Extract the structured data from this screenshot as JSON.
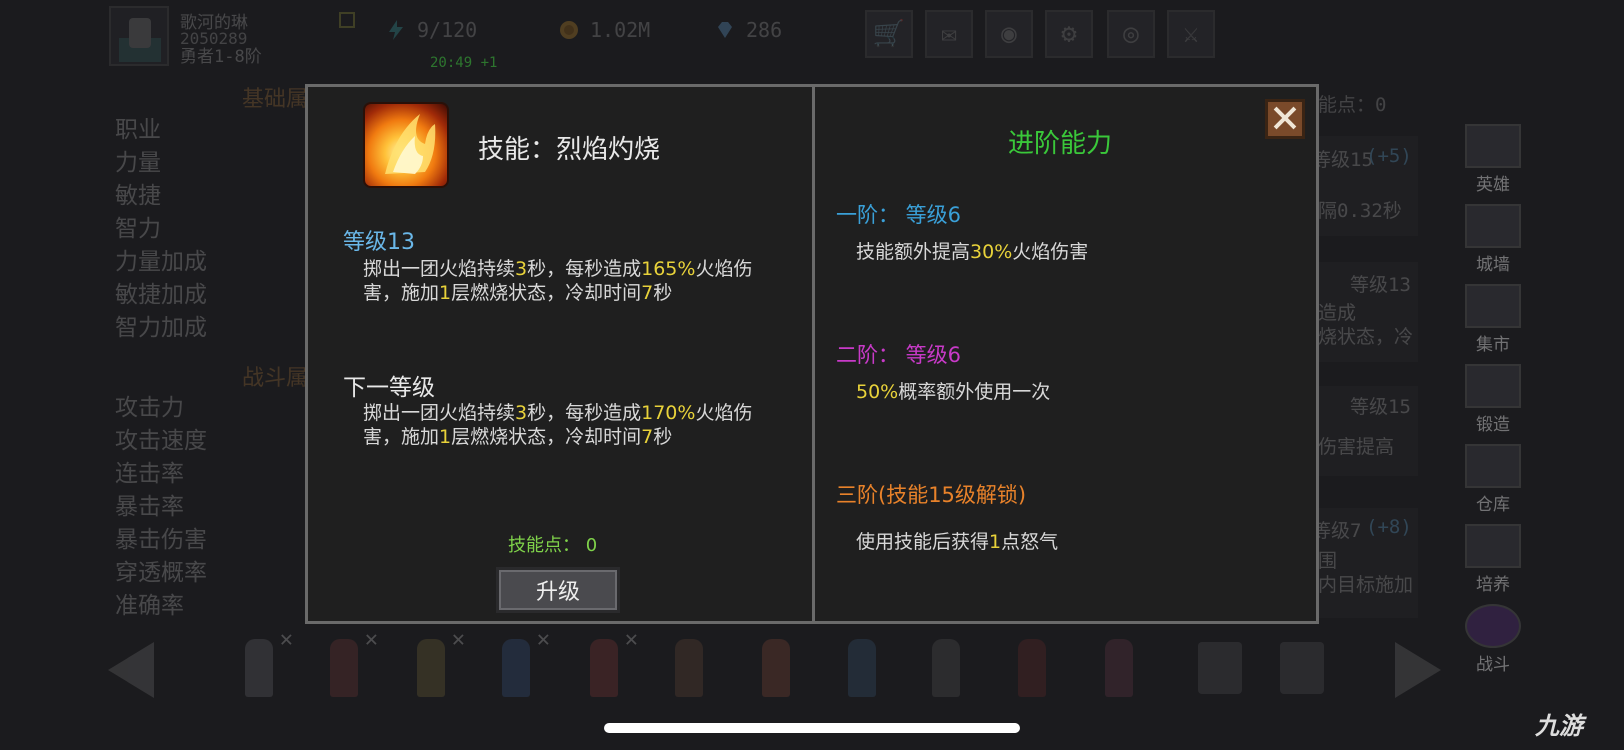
{
  "player": {
    "name": "歌河的琳",
    "id": "2050289",
    "rank": "勇者1-8阶"
  },
  "stats": {
    "energy": "9/120",
    "energy_timer": "20:49 +1",
    "gold": "1.02M",
    "gems": "286"
  },
  "background": {
    "basic_title": "基础属",
    "combat_title": "战斗属",
    "basic_stats": [
      "职业",
      "力量",
      "敏捷",
      "智力",
      "力量加成",
      "敏捷加成",
      "智力加成"
    ],
    "combat_stats": [
      "攻击力",
      "攻击速度",
      "连击率",
      "暴击率",
      "暴击伤害",
      "穿透概率",
      "准确率"
    ],
    "skill_points": "能点：0",
    "cards": [
      {
        "lines": [
          "等级15",
          "(+5)",
          "隔0.32秒"
        ]
      },
      {
        "lines": [
          "等级13",
          "造成",
          "烧状态，冷"
        ]
      },
      {
        "lines": [
          "等级15",
          "伤害提高"
        ]
      },
      {
        "lines": [
          "等级7",
          "(+8)",
          "围",
          "内目标施加"
        ]
      }
    ]
  },
  "nav": [
    "英雄",
    "城墙",
    "集市",
    "锻造",
    "仓库",
    "培养",
    "战斗"
  ],
  "modal": {
    "skill_title": "技能：烈焰灼烧",
    "level": "等级13",
    "current_desc": [
      "掷出一团火焰持续",
      "3",
      "秒，每秒造成",
      "165%",
      "火焰伤害，施加",
      "1",
      "层燃烧状态，冷却时间",
      "7",
      "秒"
    ],
    "next_label": "下一等级",
    "next_desc": [
      "掷出一团火焰持续",
      "3",
      "秒，每秒造成",
      "170%",
      "火焰伤害，施加",
      "1",
      "层燃烧状态，冷却时间",
      "7",
      "秒"
    ],
    "skill_points": "技能点： 0",
    "upgrade_label": "升级",
    "advanced_title": "进阶能力",
    "tiers": [
      {
        "label": "一阶： 等级6",
        "color": "#3aa0d8",
        "desc": [
          "技能额外提高",
          "30%",
          "火焰伤害"
        ]
      },
      {
        "label": "二阶： 等级6",
        "color": "#c83ac8",
        "desc": [
          "",
          "50%",
          "概率额外使用一次"
        ]
      },
      {
        "label": "三阶(技能15级解锁)",
        "color": "#e8822a",
        "desc": [
          "使用技能后获得",
          "1",
          "点怒气"
        ]
      }
    ]
  },
  "watermark": "九游"
}
